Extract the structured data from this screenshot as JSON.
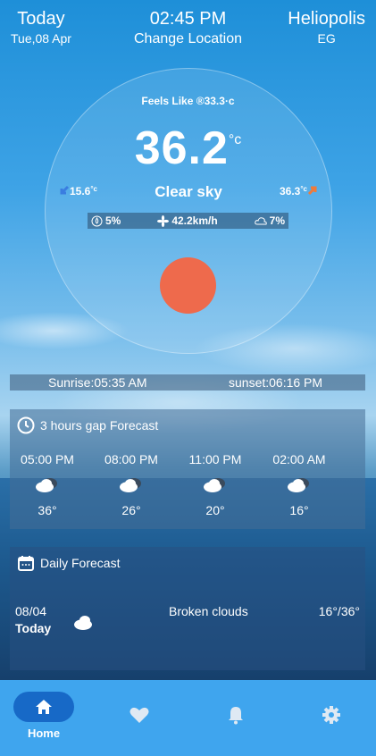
{
  "header": {
    "day_label": "Today",
    "date": "Tue,08 Apr",
    "time": "02:45 PM",
    "change_location": "Change Location",
    "city": "Heliopolis",
    "country": "EG"
  },
  "current": {
    "feels_like": "Feels Like ®33.3·c",
    "temperature": "36.2",
    "unit": "°c",
    "min_temp": "15.6",
    "min_unit": "°c",
    "max_temp": "36.3",
    "max_unit": "°c",
    "description": "Clear sky",
    "humidity": "5%",
    "wind": "42.2km/h",
    "clouds": "7%"
  },
  "sun": {
    "sunrise": "Sunrise:05:35 AM",
    "sunset": "sunset:06:16 PM"
  },
  "hourly": {
    "title": "3 hours gap Forecast",
    "items": [
      {
        "time": "05:00 PM",
        "temp": "36°"
      },
      {
        "time": "08:00 PM",
        "temp": "26°"
      },
      {
        "time": "11:00 PM",
        "temp": "20°"
      },
      {
        "time": "02:00 AM",
        "temp": "16°"
      }
    ]
  },
  "daily": {
    "title": "Daily Forecast",
    "items": [
      {
        "date": "08/04",
        "day": "Today",
        "description": "Broken clouds",
        "range": "16°/36°"
      }
    ]
  },
  "nav": {
    "home_label": "Home"
  },
  "colors": {
    "sun": "#ee6a4c",
    "nav_bg": "#3fa5ee",
    "nav_active": "#1769c7",
    "min_arrow": "#3a7de0",
    "max_arrow": "#f07a3a"
  }
}
